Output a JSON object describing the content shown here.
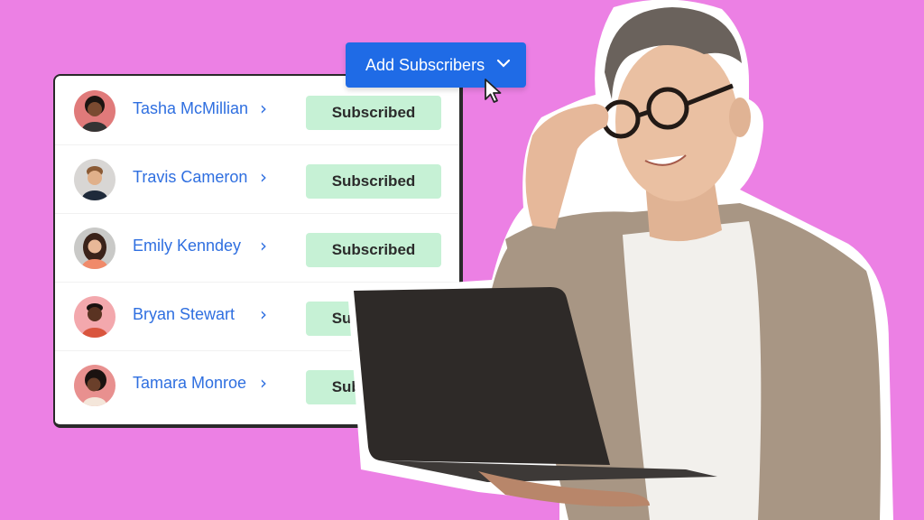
{
  "toolbar": {
    "add_subscribers_label": "Add Subscribers",
    "dropdown_icon": "chevron-down-icon",
    "cursor_icon": "arrow-cursor-icon"
  },
  "subscribers": [
    {
      "name": "Tasha McMillian",
      "status": "Subscribed",
      "avatar_bg": "#e07a7a"
    },
    {
      "name": "Travis Cameron",
      "status": "Subscribed",
      "avatar_bg": "#d8d6d4"
    },
    {
      "name": "Emily Kenndey",
      "status": "Subscribed",
      "avatar_bg": "#c9c9c7"
    },
    {
      "name": "Bryan Stewart",
      "status": "Subscribed",
      "avatar_bg": "#f3a8ad"
    },
    {
      "name": "Tamara Monroe",
      "status": "Subscribed",
      "avatar_bg": "#e8908f"
    }
  ],
  "colors": {
    "background": "#ec80e4",
    "accent": "#1f6be6",
    "link": "#2f6fe0",
    "badge_bg": "#c6f1d5"
  },
  "chevron_glyph": "›"
}
